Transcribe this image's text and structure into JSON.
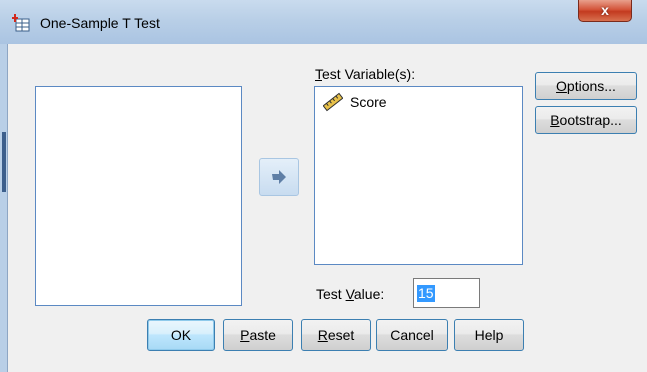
{
  "window": {
    "title": "One-Sample T Test",
    "close_label": "x"
  },
  "source_list": {
    "items": []
  },
  "target_list": {
    "label_prefix": "",
    "label_ul": "T",
    "label_rest": "est Variable(s):",
    "items": [
      {
        "label": "Score",
        "icon": "ruler-scale-icon"
      }
    ]
  },
  "side_buttons": {
    "options": {
      "ul": "O",
      "rest": "ptions..."
    },
    "bootstrap": {
      "ul": "B",
      "rest": "ootstrap..."
    }
  },
  "test_value": {
    "label_pre": "Test ",
    "label_ul": "V",
    "label_post": "alue:",
    "value": "15"
  },
  "bottom_buttons": {
    "ok": "OK",
    "paste": {
      "ul": "P",
      "rest": "aste"
    },
    "reset": {
      "ul": "R",
      "rest": "eset"
    },
    "cancel": "Cancel",
    "help": "Help"
  },
  "colors": {
    "title_bar": "#b9cfe7",
    "list_border": "#5b89c3",
    "selection": "#3399ff",
    "close_button": "#c33a1f"
  }
}
